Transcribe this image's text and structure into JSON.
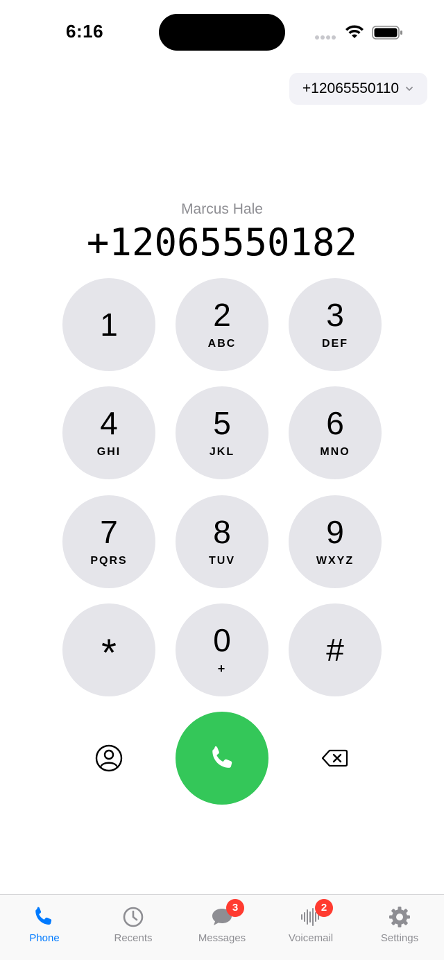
{
  "status_bar": {
    "time": "6:16"
  },
  "caller_line": {
    "number": "+12065550110"
  },
  "dialer": {
    "contact_name": "Marcus Hale",
    "number": "+12065550182"
  },
  "keypad": {
    "keys": [
      {
        "digit": "1",
        "letters": ""
      },
      {
        "digit": "2",
        "letters": "ABC"
      },
      {
        "digit": "3",
        "letters": "DEF"
      },
      {
        "digit": "4",
        "letters": "GHI"
      },
      {
        "digit": "5",
        "letters": "JKL"
      },
      {
        "digit": "6",
        "letters": "MNO"
      },
      {
        "digit": "7",
        "letters": "PQRS"
      },
      {
        "digit": "8",
        "letters": "TUV"
      },
      {
        "digit": "9",
        "letters": "WXYZ"
      },
      {
        "digit": "*",
        "letters": ""
      },
      {
        "digit": "0",
        "letters": "+"
      },
      {
        "digit": "#",
        "letters": ""
      }
    ]
  },
  "colors": {
    "accent": "#007aff",
    "call_green": "#34c759",
    "badge_red": "#ff3b30",
    "key_gray": "#e5e5ea"
  },
  "tabs": [
    {
      "label": "Phone",
      "icon": "phone-icon",
      "active": true,
      "badge": ""
    },
    {
      "label": "Recents",
      "icon": "clock-icon",
      "active": false,
      "badge": ""
    },
    {
      "label": "Messages",
      "icon": "message-bubble-icon",
      "active": false,
      "badge": "3"
    },
    {
      "label": "Voicemail",
      "icon": "waveform-icon",
      "active": false,
      "badge": "2"
    },
    {
      "label": "Settings",
      "icon": "gear-icon",
      "active": false,
      "badge": ""
    }
  ]
}
